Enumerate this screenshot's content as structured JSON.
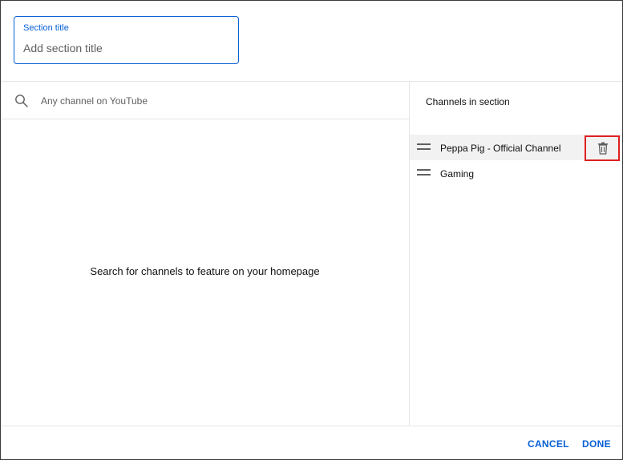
{
  "section_title_field": {
    "label": "Section title",
    "placeholder": "Add section title",
    "value": ""
  },
  "search": {
    "placeholder": "Any channel on YouTube",
    "icon": "search-icon"
  },
  "left_pane": {
    "empty_message": "Search for channels to feature on your homepage"
  },
  "right_pane": {
    "header": "Channels in section",
    "channels": [
      {
        "name": "Peppa Pig - Official Channel",
        "hovered": true
      },
      {
        "name": "Gaming",
        "hovered": false
      }
    ]
  },
  "footer": {
    "cancel_label": "CANCEL",
    "done_label": "DONE"
  },
  "colors": {
    "accent": "#065fd4",
    "highlight_box": "#e02020",
    "divider": "#e5e5e5"
  }
}
